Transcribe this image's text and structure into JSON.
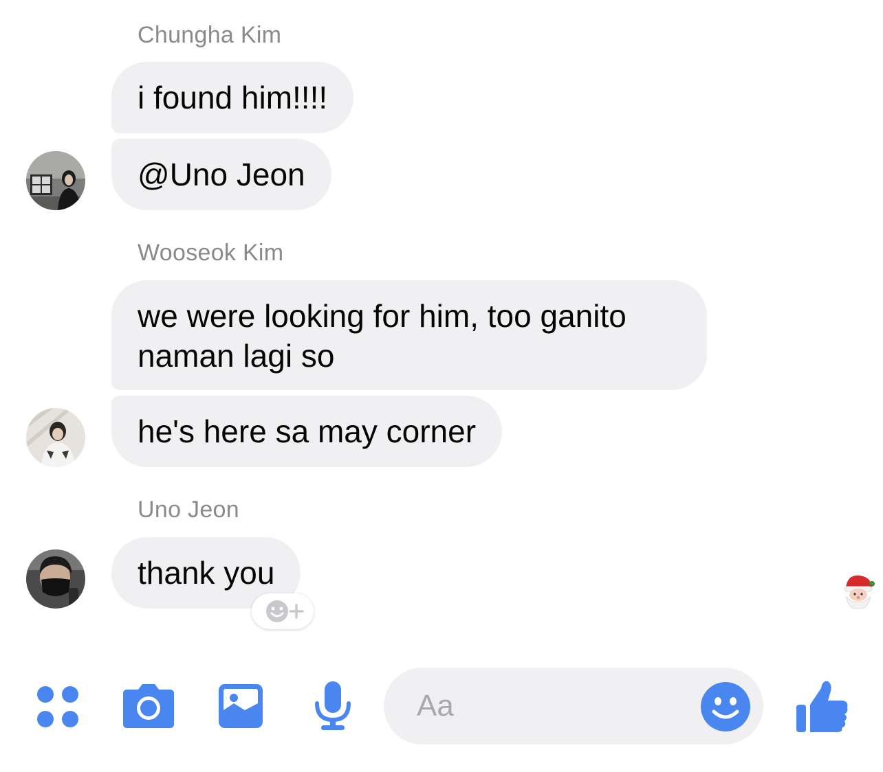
{
  "thread": {
    "groups": [
      {
        "sender": "Chungha Kim",
        "messages": [
          "i found him!!!!",
          "@Uno Jeon"
        ]
      },
      {
        "sender": "Wooseok Kim",
        "messages": [
          "we were looking for him, too ganito naman lagi so",
          "he's here sa may corner"
        ]
      },
      {
        "sender": "Uno Jeon",
        "messages": [
          "thank you"
        ]
      }
    ]
  },
  "composer": {
    "placeholder": "Aa",
    "accent_color": "#4a86f0"
  },
  "icons": [
    "apps-icon",
    "camera-icon",
    "gallery-icon",
    "microphone-icon",
    "emoji-icon",
    "like-icon",
    "add-reaction-icon",
    "santa-icon"
  ],
  "colors": {
    "bubble": "#f0f0f2",
    "name_text": "#8a8a8e",
    "accent": "#4a86f0"
  }
}
